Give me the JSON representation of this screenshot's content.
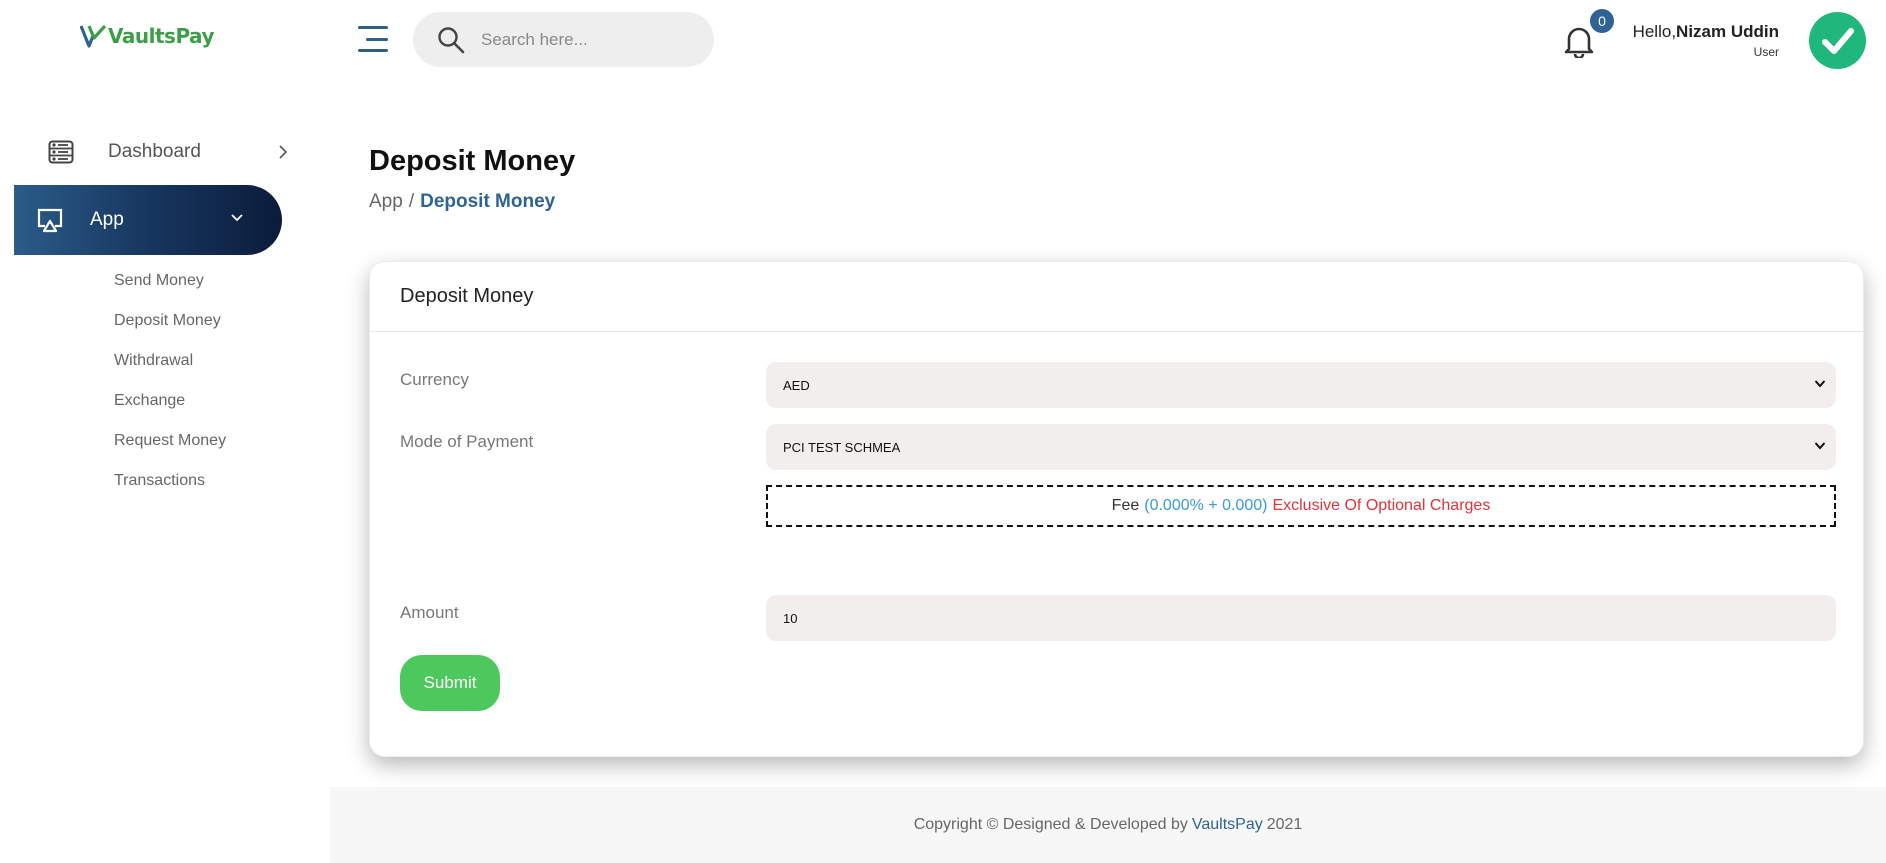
{
  "header": {
    "logo_text": "VaultsPay",
    "search_placeholder": "Search here...",
    "notification_count": "0",
    "greeting": "Hello,",
    "user_name": "Nizam Uddin",
    "user_role": "User"
  },
  "sidebar": {
    "items": [
      {
        "label": "Dashboard",
        "icon": "dashboard-icon"
      },
      {
        "label": "App",
        "icon": "monitor-icon",
        "active": true
      }
    ],
    "submenu": [
      "Send Money",
      "Deposit Money",
      "Withdrawal",
      "Exchange",
      "Request Money",
      "Transactions"
    ]
  },
  "page": {
    "title": "Deposit Money",
    "breadcrumb": [
      "App",
      "Deposit Money"
    ]
  },
  "card": {
    "title": "Deposit Money",
    "currency_label": "Currency",
    "currency_value": "AED",
    "payment_label": "Mode of Payment",
    "payment_value": "PCI TEST SCHMEA",
    "fee_prefix": "Fee",
    "fee_value": "(0.000% + 0.000)",
    "fee_note": "Exclusive Of Optional Charges",
    "amount_label": "Amount",
    "amount_value": "10",
    "submit_label": "Submit"
  },
  "footer": {
    "prefix": "Copyright © Designed & Developed by",
    "brand": "VaultsPay",
    "year": "2021"
  },
  "colors": {
    "brand_green": "#3d9e48",
    "accent_blue": "#2e6394",
    "submit_green": "#4cc85d",
    "fee_blue": "#3a9ad9",
    "fee_red": "#e0333a",
    "avatar_green": "#1fb77b"
  }
}
